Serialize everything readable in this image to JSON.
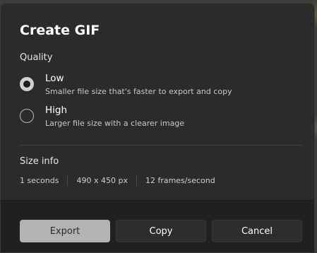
{
  "dialog": {
    "title": "Create GIF"
  },
  "quality": {
    "label": "Quality",
    "options": [
      {
        "title": "Low",
        "description": "Smaller file size that's faster to export and copy",
        "selected": true
      },
      {
        "title": "High",
        "description": "Larger file size with a clearer image",
        "selected": false
      }
    ]
  },
  "size_info": {
    "label": "Size info",
    "duration": "1 seconds",
    "dimensions": "490 x 450 px",
    "frame_rate": "12 frames/second"
  },
  "buttons": {
    "export": "Export",
    "copy": "Copy",
    "cancel": "Cancel"
  },
  "colors": {
    "dialog_bg": "#2b2b2b",
    "footer_bg": "#202020",
    "primary_button": "#b3b3b3"
  }
}
